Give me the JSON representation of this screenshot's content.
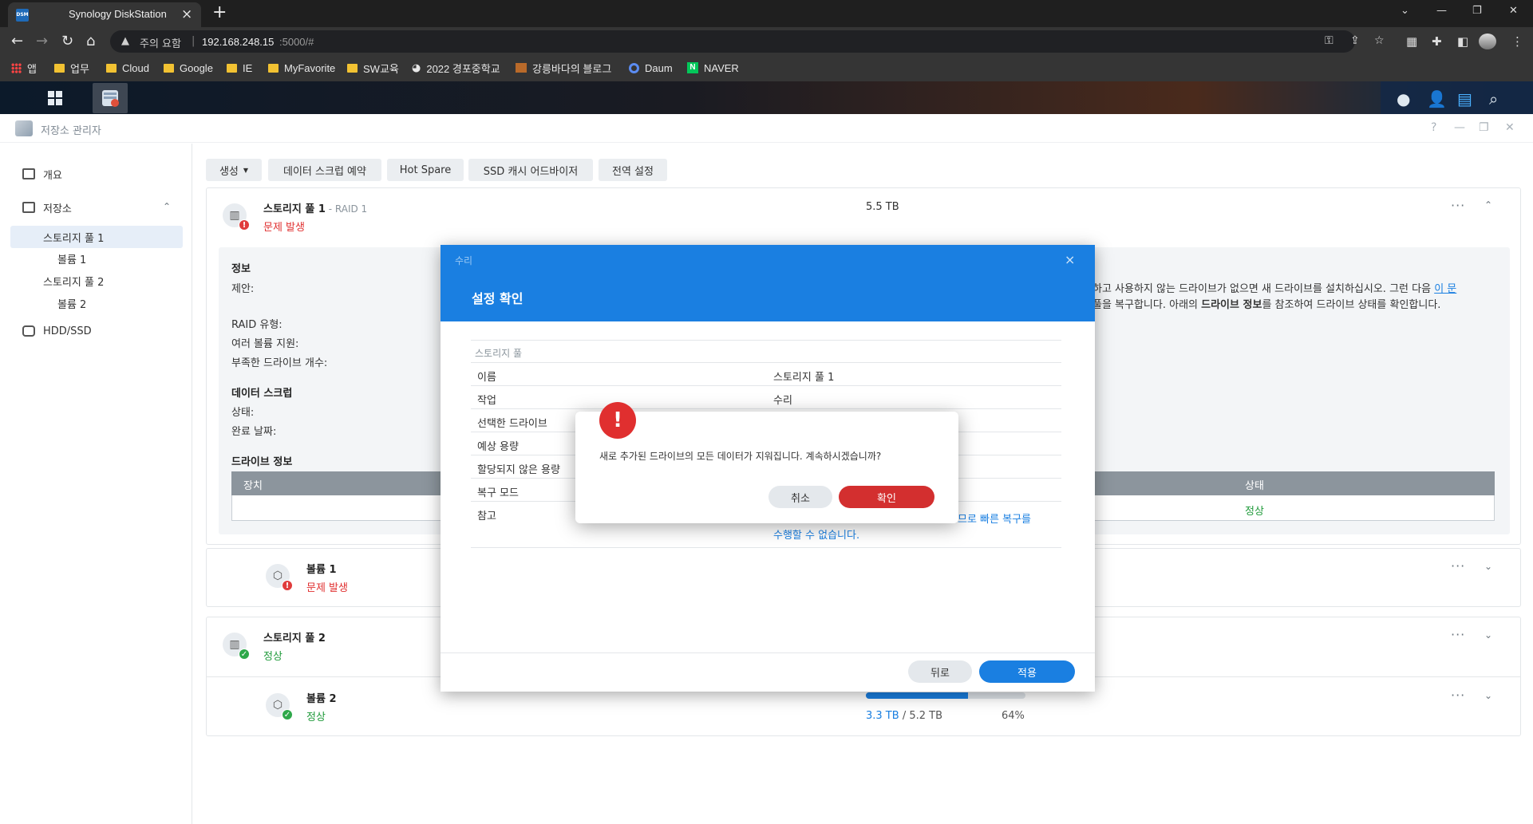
{
  "browser": {
    "tab_favicon": "DSM",
    "tab_title": "Synology DiskStation",
    "tab_close": "×",
    "new_tab": "+",
    "win_min": "—",
    "win_restore": "❐",
    "win_close": "✕",
    "tab_menu": "⌄",
    "security_warning": "주의 요함",
    "url_host": "192.168.248.15",
    "url_path": ":5000/#",
    "bookmarks": [
      "앱",
      "업무",
      "Cloud",
      "Google",
      "IE",
      "MyFavorite",
      "SW교육",
      "2022 경포중학교",
      "강릉바다의 블로그",
      "Daum",
      "NAVER"
    ]
  },
  "app": {
    "title": "저장소 관리자",
    "help": "?",
    "minimize": "—",
    "maximize": "❐",
    "close": "✕"
  },
  "sidebar": {
    "overview": "개요",
    "storage": "저장소",
    "pool1": "스토리지 풀 1",
    "volume1": "볼륨 1",
    "pool2": "스토리지 풀 2",
    "volume2": "볼륨 2",
    "hdd": "HDD/SSD"
  },
  "toolbar": {
    "create": "생성",
    "scrub": "데이터 스크럽 예약",
    "hotspare": "Hot Spare",
    "ssd_cache": "SSD 캐시 어드바이저",
    "global": "전역 설정"
  },
  "pool1": {
    "name": "스토리지 풀 1",
    "raid": "- RAID 1",
    "status": "문제 발생",
    "size": "5.5 TB",
    "info_heading": "정보",
    "suggestion_label": "제안:",
    "raid_type_label": "RAID 유형:",
    "multi_volume_label": "여러 볼륨 지원:",
    "missing_drives_label": "부족한 드라이브 개수:",
    "scrub_heading": "데이터 스크럽",
    "scrub_status_label": "상태:",
    "scrub_done_label": "완료 날짜:",
    "drive_info_heading": "드라이브 정보",
    "col_device": "장치",
    "col_status": "상태",
    "drive_status": "정상",
    "suggestion_line1_a": "하고 사용하지 않는 드라이브가 없으면 새 드라이브를 설치하십시오. 그런 다음 ",
    "suggestion_line1_link": "이 문",
    "suggestion_line2_a": "풀을 복구합니다. 아래의 ",
    "suggestion_line2_b": "드라이브 정보",
    "suggestion_line2_c": "를 참조하여 드라이브 상태를 확인합니다."
  },
  "volume1": {
    "name": "볼륨 1",
    "status": "문제 발생"
  },
  "pool2": {
    "name": "스토리지 풀 2",
    "status": "정상"
  },
  "volume2": {
    "name": "볼륨 2",
    "status": "정상",
    "used": "3.3 TB",
    "slash": "/",
    "total": "5.2 TB",
    "percent": "64%",
    "usage_fraction": 0.64
  },
  "dialog": {
    "subtitle": "수리",
    "title": "설정 확인",
    "close": "×",
    "section": "스토리지 풀",
    "rows": [
      {
        "label": "이름",
        "value": "스토리지 풀 1"
      },
      {
        "label": "작업",
        "value": "수리"
      },
      {
        "label": "선택한 드라이브",
        "value": ""
      },
      {
        "label": "예상 용량",
        "value": ""
      },
      {
        "label": "할당되지 않은 용량",
        "value": ""
      },
      {
        "label": "복구 모드",
        "value": ""
      },
      {
        "label": "참고",
        "value": ""
      }
    ],
    "note_line1": "므로 빠른 복구를",
    "note_line2": "수행할 수 없습니다.",
    "back": "뒤로",
    "apply": "적용"
  },
  "confirm": {
    "icon": "!",
    "message": "새로 추가된 드라이브의 모든 데이터가 지워집니다. 계속하시겠습니까?",
    "cancel": "취소",
    "ok": "확인"
  },
  "colors": {
    "accent": "#1a7fe1",
    "danger": "#e02f2f",
    "ok": "#1f9a3a"
  }
}
